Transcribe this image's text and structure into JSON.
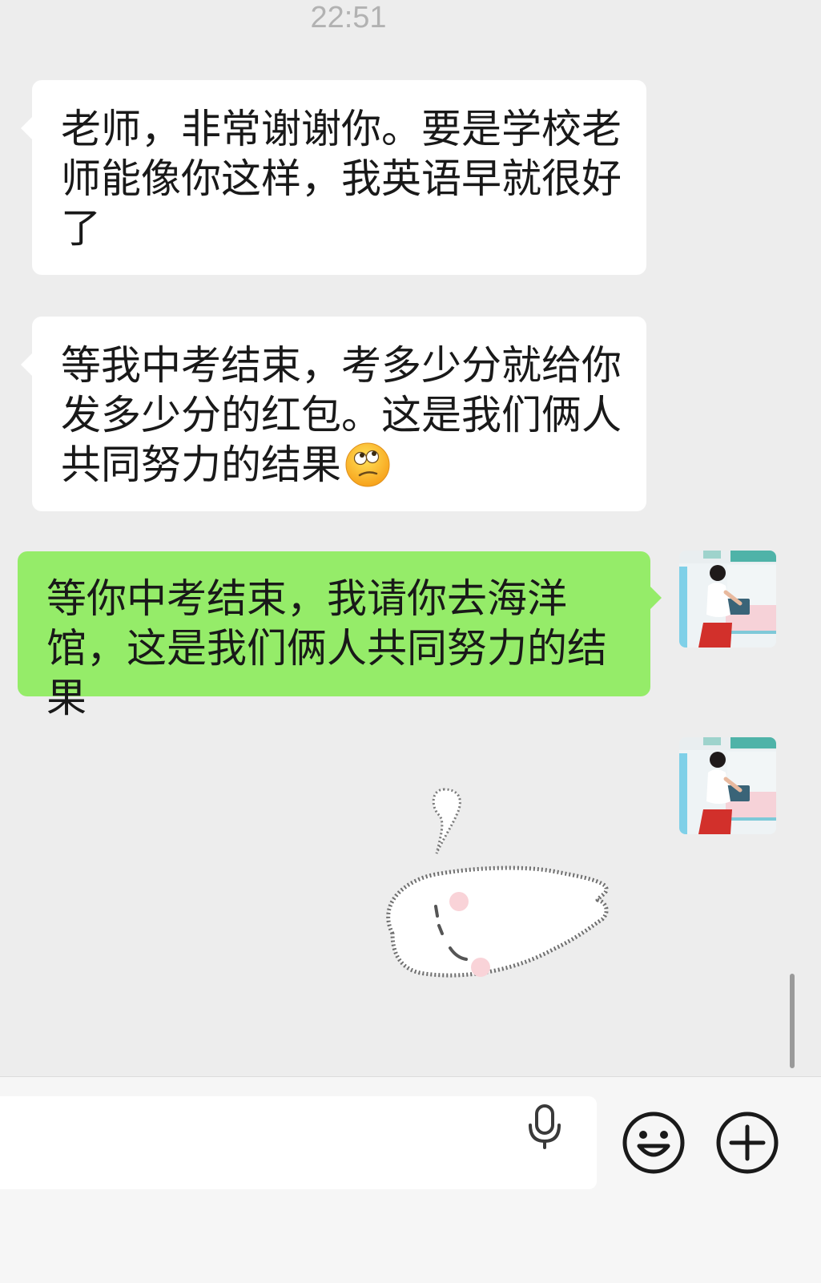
{
  "chat": {
    "timestamp": "22:51",
    "messages": [
      {
        "direction": "incoming",
        "text": "老师，非常谢谢你。要是学校老师能像你这样，我英语早就很好了"
      },
      {
        "direction": "incoming",
        "text": "等我中考结束，考多少分就给你发多少分的红包。这是我们俩人共同努力的结果",
        "trailing_emoji": "confused-face-emoji"
      },
      {
        "direction": "outgoing",
        "text": "等你中考结束，我请你去海洋馆，这是我们俩人共同努力的结果",
        "avatar": "user-avatar-photo"
      },
      {
        "direction": "outgoing",
        "type": "sticker",
        "sticker": "lying-ghost-sticker",
        "avatar": "user-avatar-photo"
      }
    ]
  },
  "input_bar": {
    "message_value": "",
    "icons": [
      "microphone-icon",
      "emoji-icon",
      "plus-icon"
    ]
  },
  "colors": {
    "background": "#ededed",
    "incoming_bubble": "#ffffff",
    "outgoing_bubble": "#95ec69",
    "text": "#191919",
    "timestamp": "#b2b2b2"
  }
}
